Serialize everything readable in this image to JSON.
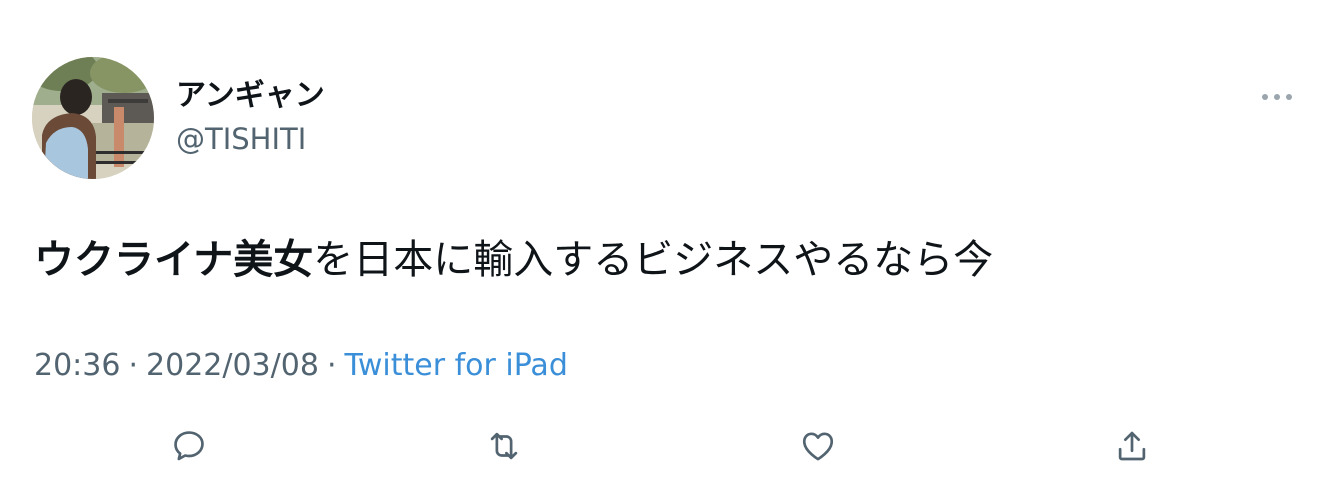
{
  "user": {
    "display_name": "アンギャン",
    "handle": "@TISHITI"
  },
  "tweet": {
    "text_bold": "ウクライナ美女",
    "text_rest": "を日本に輸入するビジネスやるなら今",
    "time": "20:36",
    "separator": "·",
    "date": "2022/03/08",
    "source": "Twitter for iPad"
  },
  "actions": {
    "icons": [
      "reply-icon",
      "retweet-icon",
      "like-icon",
      "share-icon"
    ]
  },
  "colors": {
    "text": "#0f1419",
    "secondary": "#536471",
    "link": "#3b8fd9",
    "icon": "#536471"
  }
}
